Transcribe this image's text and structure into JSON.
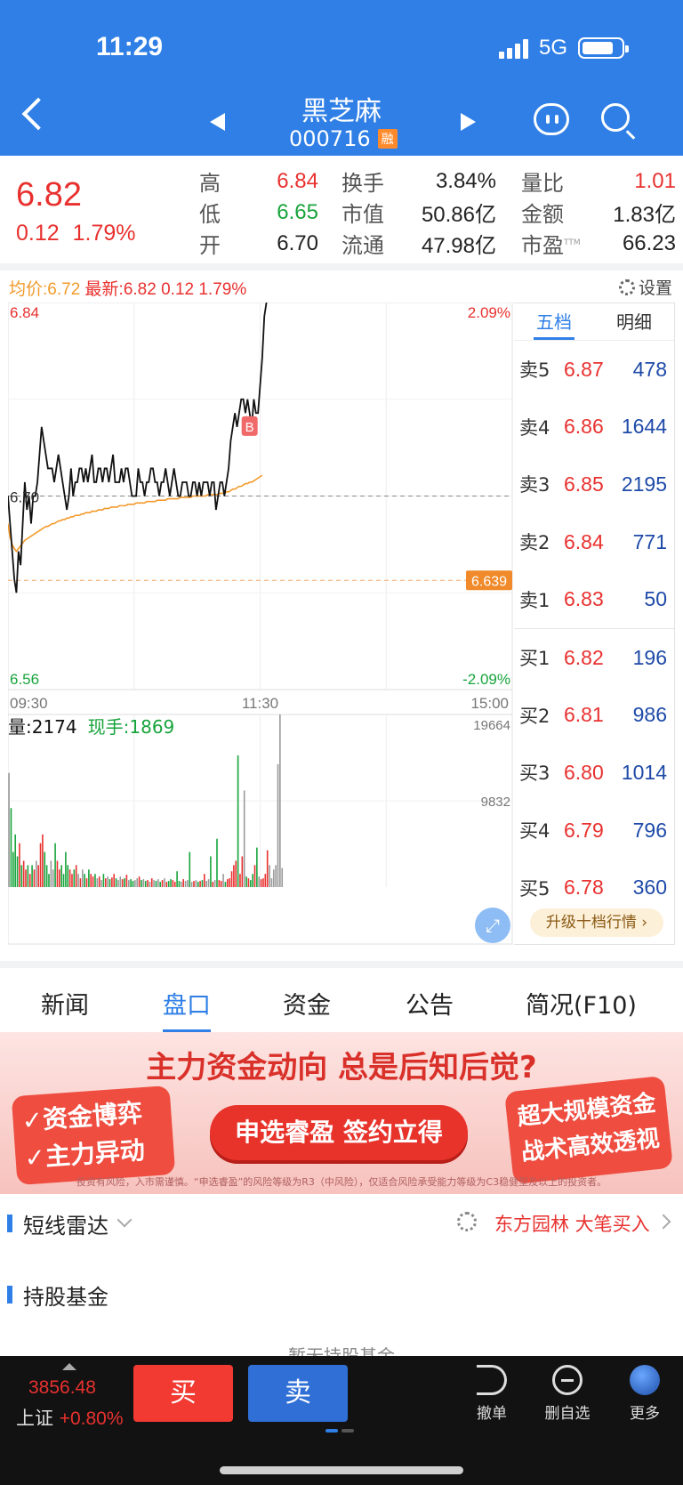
{
  "status": {
    "time": "11:29",
    "network": "5G"
  },
  "header": {
    "title": "黑芝麻",
    "code": "000716",
    "margin_badge": "融",
    "icons": [
      "back-icon",
      "prev-icon",
      "next-icon",
      "robot-icon",
      "search-icon"
    ]
  },
  "quote": {
    "price": "6.82",
    "change": "0.12",
    "change_pct": "1.79%",
    "rows": [
      {
        "l1": "高",
        "v1": "6.84",
        "l2": "换手",
        "v2": "3.84%",
        "l3": "量比",
        "v3": "1.01"
      },
      {
        "l1": "低",
        "v1": "6.65",
        "l2": "市值",
        "v2": "50.86亿",
        "l3": "金额",
        "v3": "1.83亿"
      },
      {
        "l1": "开",
        "v1": "6.70",
        "l2": "流通",
        "v2": "47.98亿",
        "l3": "市盈",
        "v3": "66.23",
        "l3_sup": "TTM"
      }
    ]
  },
  "chart_header": {
    "avg_label": "均价:6.72",
    "latest_label": "最新:6.82",
    "change": "0.12",
    "pct": "1.79%",
    "settings": "设置"
  },
  "chart_data": {
    "type": "line",
    "title": "",
    "xlabel": "",
    "ylabel": "",
    "x_ticks": [
      "09:30",
      "11:30",
      "15:00"
    ],
    "ylim": [
      6.56,
      6.84
    ],
    "y_labels": {
      "top": "6.84",
      "bottom": "6.56",
      "top_pct": "2.09%",
      "bottom_pct": "-2.09%",
      "ref": "6.70"
    },
    "prev_close": 6.7,
    "marker_line": {
      "value": 6.639,
      "label": "6.639"
    },
    "buy_marker": {
      "label": "B",
      "time_index": 115,
      "price": 6.75
    },
    "price_series": [
      6.7,
      6.68,
      6.66,
      6.64,
      6.63,
      6.66,
      6.65,
      6.68,
      6.71,
      6.69,
      6.7,
      6.68,
      6.7,
      6.7,
      6.71,
      6.73,
      6.75,
      6.74,
      6.73,
      6.72,
      6.72,
      6.72,
      6.71,
      6.72,
      6.73,
      6.72,
      6.71,
      6.7,
      6.69,
      6.7,
      6.72,
      6.7,
      6.71,
      6.71,
      6.72,
      6.72,
      6.71,
      6.72,
      6.71,
      6.72,
      6.73,
      6.71,
      6.71,
      6.72,
      6.72,
      6.71,
      6.72,
      6.72,
      6.71,
      6.72,
      6.73,
      6.71,
      6.71,
      6.71,
      6.72,
      6.71,
      6.72,
      6.72,
      6.71,
      6.7,
      6.7,
      6.7,
      6.72,
      6.71,
      6.71,
      6.7,
      6.71,
      6.71,
      6.72,
      6.72,
      6.71,
      6.71,
      6.7,
      6.71,
      6.71,
      6.72,
      6.71,
      6.7,
      6.71,
      6.72,
      6.71,
      6.7,
      6.7,
      6.71,
      6.71,
      6.71,
      6.7,
      6.7,
      6.71,
      6.71,
      6.7,
      6.71,
      6.7,
      6.71,
      6.71,
      6.71,
      6.7,
      6.71,
      6.71,
      6.69,
      6.7,
      6.71,
      6.71,
      6.7,
      6.71,
      6.72,
      6.74,
      6.75,
      6.76,
      6.75,
      6.76,
      6.77,
      6.77,
      6.76,
      6.77,
      6.76,
      6.75,
      6.77,
      6.76,
      6.76,
      6.78,
      6.8,
      6.83,
      6.84
    ],
    "avg_series": [
      6.68,
      6.67,
      6.665,
      6.662,
      6.66,
      6.662,
      6.664,
      6.666,
      6.668,
      6.669,
      6.67,
      6.671,
      6.672,
      6.673,
      6.674,
      6.675,
      6.676,
      6.677,
      6.678,
      6.678,
      6.679,
      6.68,
      6.68,
      6.681,
      6.682,
      6.682,
      6.683,
      6.683,
      6.684,
      6.684,
      6.685,
      6.685,
      6.686,
      6.686,
      6.686,
      6.687,
      6.687,
      6.688,
      6.688,
      6.688,
      6.689,
      6.689,
      6.689,
      6.69,
      6.69,
      6.69,
      6.691,
      6.691,
      6.691,
      6.692,
      6.692,
      6.692,
      6.692,
      6.693,
      6.693,
      6.693,
      6.693,
      6.694,
      6.694,
      6.694,
      6.694,
      6.695,
      6.695,
      6.695,
      6.695,
      6.695,
      6.696,
      6.696,
      6.696,
      6.696,
      6.696,
      6.697,
      6.697,
      6.697,
      6.697,
      6.697,
      6.698,
      6.698,
      6.698,
      6.698,
      6.698,
      6.698,
      6.699,
      6.699,
      6.699,
      6.699,
      6.699,
      6.699,
      6.7,
      6.7,
      6.7,
      6.7,
      6.7,
      6.7,
      6.7,
      6.701,
      6.701,
      6.701,
      6.701,
      6.701,
      6.701,
      6.702,
      6.702,
      6.702,
      6.703,
      6.703,
      6.704,
      6.705,
      6.705,
      6.706,
      6.707,
      6.707,
      6.708,
      6.709,
      6.709,
      6.71,
      6.71,
      6.711,
      6.712,
      6.713,
      6.714,
      6.715
    ],
    "volume_label": "量:2174",
    "hand_label": "现手:1869",
    "vol_ticks": [
      "19664",
      "9832"
    ],
    "vol_max": 19664,
    "volumes": [
      13000,
      9000,
      4000,
      6000,
      3500,
      5000,
      2500,
      3000,
      2000,
      2500,
      1500,
      2500,
      2000,
      3000,
      2500,
      5000,
      6000,
      4000,
      2500,
      1500,
      3000,
      2000,
      5000,
      3000,
      2000,
      2500,
      1500,
      4000,
      2500,
      2000,
      1500,
      2000,
      2500,
      1500,
      1000,
      2000,
      1500,
      1000,
      2000,
      1500,
      1200,
      1500,
      1000,
      1200,
      800,
      1500,
      1000,
      1200,
      900,
      1100,
      1500,
      1000,
      800,
      1200,
      900,
      1000,
      1400,
      800,
      900,
      700,
      800,
      1000,
      1200,
      800,
      900,
      700,
      800,
      600,
      1000,
      800,
      700,
      900,
      600,
      800,
      1000,
      600,
      700,
      900,
      800,
      600,
      1800,
      700,
      600,
      900,
      700,
      800,
      4000,
      600,
      700,
      800,
      600,
      700,
      800,
      1500,
      700,
      900,
      3500,
      600,
      800,
      5500,
      800,
      700,
      1500,
      600,
      900,
      1000,
      1800,
      2500,
      3000,
      15000,
      1500,
      3500,
      11000,
      1200,
      1000,
      800,
      1500,
      2500,
      4500,
      1200,
      900,
      1000,
      1500,
      4200,
      2500,
      1000,
      2000,
      2500,
      14000,
      19664,
      2174
    ],
    "vol_colors": "rgm"
  },
  "order_book": {
    "tabs": [
      "五档",
      "明细"
    ],
    "asks": [
      {
        "name": "卖5",
        "price": "6.87",
        "vol": "478"
      },
      {
        "name": "卖4",
        "price": "6.86",
        "vol": "1644"
      },
      {
        "name": "卖3",
        "price": "6.85",
        "vol": "2195"
      },
      {
        "name": "卖2",
        "price": "6.84",
        "vol": "771"
      },
      {
        "name": "卖1",
        "price": "6.83",
        "vol": "50"
      }
    ],
    "bids": [
      {
        "name": "买1",
        "price": "6.82",
        "vol": "196"
      },
      {
        "name": "买2",
        "price": "6.81",
        "vol": "986"
      },
      {
        "name": "买3",
        "price": "6.80",
        "vol": "1014"
      },
      {
        "name": "买4",
        "price": "6.79",
        "vol": "796"
      },
      {
        "name": "买5",
        "price": "6.78",
        "vol": "360"
      }
    ],
    "upgrade": "升级十档行情 ›"
  },
  "nav": {
    "tabs": [
      "新闻",
      "盘口",
      "资金",
      "公告",
      "简况(F10)"
    ],
    "active": 1
  },
  "banner": {
    "title": "主力资金动向 总是后知后觉?",
    "left1": "资金博弈",
    "left2": "主力异动",
    "cta": "申选睿盈 签约立得",
    "right1": "超大规模资金",
    "right2": "战术高效透视",
    "disclaimer": "投资有风险，入市需谨慎。“申选睿盈”的风险等级为R3（中风险），仅适合风险承受能力等级为C3稳健型及以上的投资者。"
  },
  "radar": {
    "title": "短线雷达",
    "news": "东方园林 大笔买入"
  },
  "fund": {
    "title": "持股基金",
    "hint": "暂无持股基金"
  },
  "bottom": {
    "index_value": "3856.48",
    "index_name": "上证",
    "index_pct": "+0.80%",
    "buy": "买",
    "sell": "卖",
    "actions": [
      "撤单",
      "删自选",
      "更多"
    ]
  },
  "colors": {
    "brand": "#2f7fe6",
    "up": "#e8312f",
    "down": "#18a43c",
    "avg": "#f39a2b",
    "marker": "#f08a2a"
  }
}
